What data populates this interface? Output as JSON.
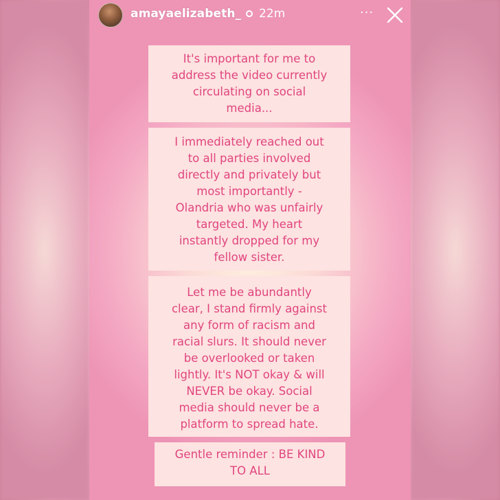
{
  "header": {
    "username": "amayaelizabeth_",
    "time_ago": "22m",
    "more_label": "···"
  },
  "cards": [
    {
      "lines": [
        "It's important for me to",
        "address the video currently",
        "circulating on social",
        "media..."
      ]
    },
    {
      "lines": [
        "I immediately reached out",
        "to all parties involved",
        "directly and privately but",
        "most  importantly -",
        "Olandria who was unfairly",
        "targeted. My heart",
        "instantly dropped for my",
        "fellow sister."
      ]
    },
    {
      "lines": [
        "Let me be abundantly",
        "clear, I stand firmly against",
        "any form of racism and",
        "racial slurs. It should never",
        "be overlooked or taken",
        "lightly. It's NOT okay & will",
        "NEVER be okay. Social",
        "media should never be a",
        "platform to spread hate."
      ]
    },
    {
      "lines": [
        "Gentle reminder : BE KIND",
        "TO ALL"
      ]
    }
  ],
  "colors": {
    "card_bg": "#fde3e1",
    "card_text": "#e0457f"
  },
  "icons": [
    "verified-icon",
    "more-icon",
    "close-icon"
  ]
}
